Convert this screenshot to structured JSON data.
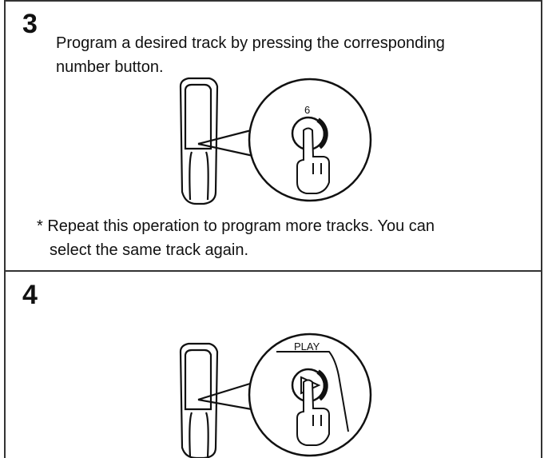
{
  "step3": {
    "number": "3",
    "instruction_line1": "Program a desired track by pressing the corresponding",
    "instruction_line2": "number button.",
    "button_label": "6",
    "note_line1": "* Repeat this operation to program more tracks. You can",
    "note_line2": "select the same track again."
  },
  "step4": {
    "number": "4",
    "button_label": "PLAY"
  },
  "icons": {
    "remote": "remote-control-icon",
    "finger": "pointing-finger-icon",
    "play": "play-triangle-icon"
  },
  "colors": {
    "ink": "#111111",
    "frame": "#333333"
  }
}
